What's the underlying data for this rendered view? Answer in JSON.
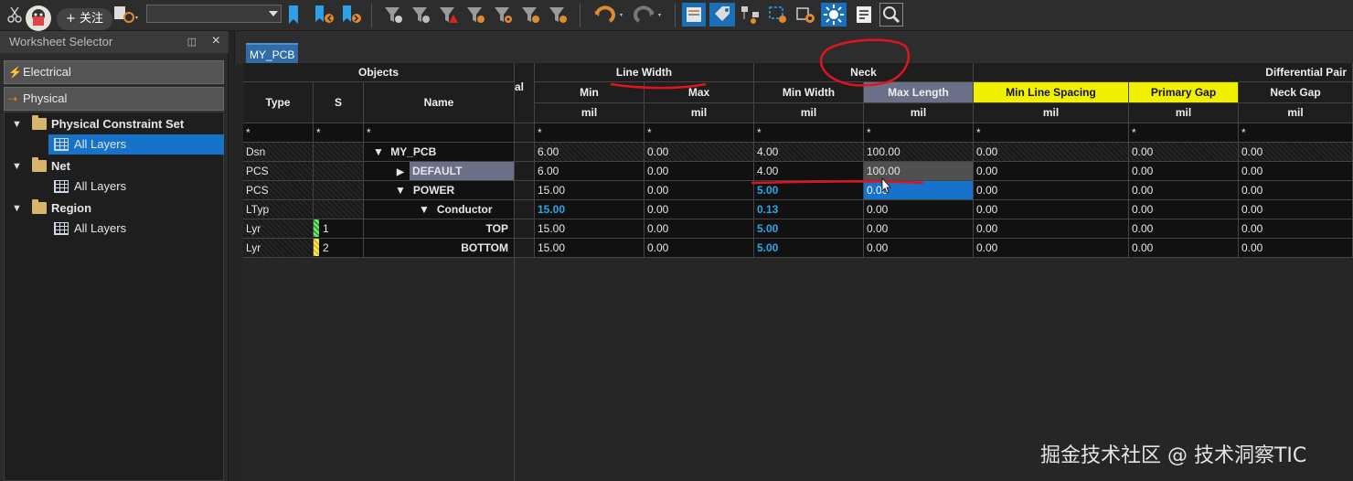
{
  "toolbar": {
    "combo_value": "",
    "follow_label": "+ 关注"
  },
  "left_panel": {
    "title": "Worksheet Selector",
    "pin_icon": "float",
    "close_icon": "×",
    "electrical": "Electrical",
    "physical": "Physical",
    "tree": [
      {
        "label": "Physical Constraint Set",
        "children": [
          "All Layers"
        ]
      },
      {
        "label": "Net",
        "children": [
          "All Layers"
        ]
      },
      {
        "label": "Region",
        "children": [
          "All Layers"
        ]
      }
    ]
  },
  "tab": {
    "label": "MY_PCB"
  },
  "header": {
    "objects": "Objects",
    "type": "Type",
    "s": "S",
    "name": "Name",
    "al": "al",
    "line_width": "Line Width",
    "neck": "Neck",
    "diff_pair": "Differential Pair",
    "min": "Min",
    "max": "Max",
    "min_width": "Min Width",
    "max_length": "Max Length",
    "min_line_spacing": "Min Line Spacing",
    "primary_gap": "Primary Gap",
    "neck_gap": "Neck Gap",
    "unit": "mil",
    "filter": "*"
  },
  "rows": [
    {
      "type": "Dsn",
      "s": "",
      "name": "MY_PCB",
      "lw_min": "6.00",
      "lw_max": "0.00",
      "nk_min": "4.00",
      "nk_max": "100.00",
      "mls": "0.00",
      "pg": "0.00",
      "ng": "0.00"
    },
    {
      "type": "PCS",
      "s": "",
      "name": "DEFAULT",
      "lw_min": "6.00",
      "lw_max": "0.00",
      "nk_min": "4.00",
      "nk_max": "100.00",
      "mls": "0.00",
      "pg": "0.00",
      "ng": "0.00"
    },
    {
      "type": "PCS",
      "s": "",
      "name": "POWER",
      "lw_min": "15.00",
      "lw_max": "0.00",
      "nk_min": "5.00",
      "nk_max": "0.00",
      "mls": "0.00",
      "pg": "0.00",
      "ng": "0.00"
    },
    {
      "type": "LTyp",
      "s": "",
      "name": "Conductor",
      "lw_min": "15.00",
      "lw_max": "0.00",
      "nk_min": "0.13",
      "nk_max": "0.00",
      "mls": "0.00",
      "pg": "0.00",
      "ng": "0.00"
    },
    {
      "type": "Lyr",
      "s": "1",
      "name": "TOP",
      "lw_min": "15.00",
      "lw_max": "0.00",
      "nk_min": "5.00",
      "nk_max": "0.00",
      "mls": "0.00",
      "pg": "0.00",
      "ng": "0.00"
    },
    {
      "type": "Lyr",
      "s": "2",
      "name": "BOTTOM",
      "lw_min": "15.00",
      "lw_max": "0.00",
      "nk_min": "5.00",
      "nk_max": "0.00",
      "mls": "0.00",
      "pg": "0.00",
      "ng": "0.00"
    }
  ],
  "watermark": "掘金技术社区 @ 技术洞察TIC",
  "colors": {
    "accent": "#1673c9",
    "highlight_yellow": "#f0f000",
    "value_blue": "#2aa7e8",
    "annotation_red": "#e0141e"
  }
}
